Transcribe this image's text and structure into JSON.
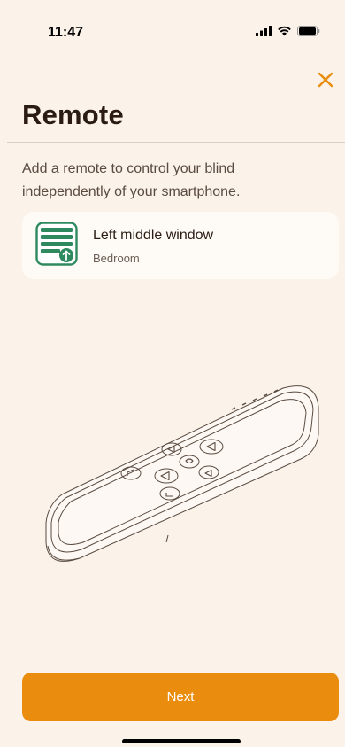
{
  "status_bar": {
    "time": "11:47"
  },
  "header": {
    "title": "Remote"
  },
  "description": "Add a remote to control your blind independently of your smartphone.",
  "device": {
    "name": "Left middle window",
    "room": "Bedroom"
  },
  "actions": {
    "next_label": "Next"
  },
  "colors": {
    "accent": "#ea8c0d",
    "background": "#fbf3ea",
    "icon_green": "#2e8a5e"
  }
}
